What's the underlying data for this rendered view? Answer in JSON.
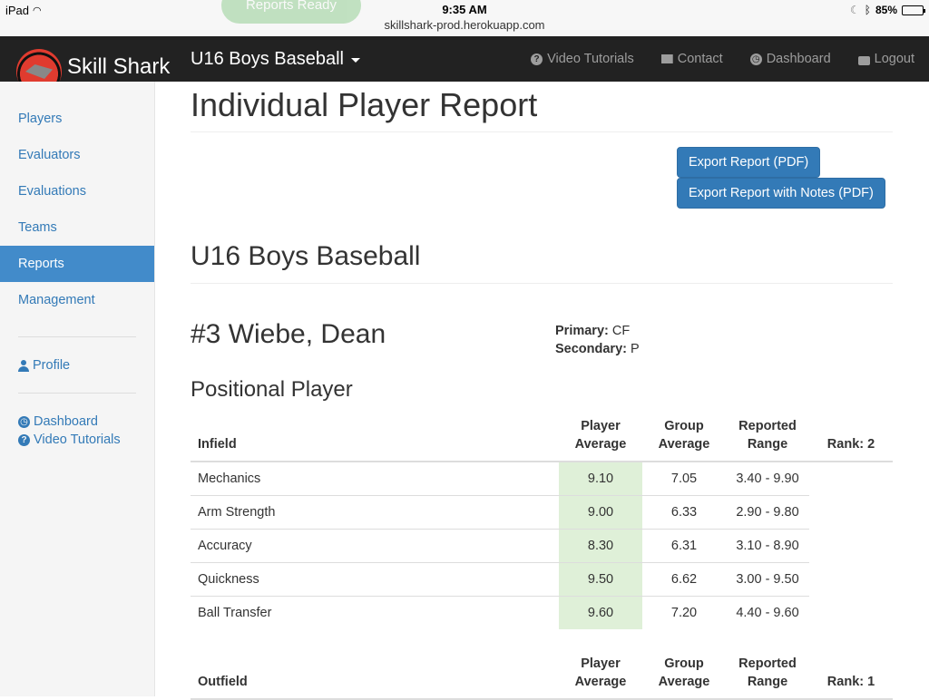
{
  "ios_bar": {
    "device": "iPad",
    "time": "9:35 AM",
    "url": "skillshark-prod.herokuapp.com",
    "battery": "85%",
    "battery_level": 0.85,
    "ghost_pill": "Reports Ready"
  },
  "navbar": {
    "brand": "Skill Shark",
    "team": "U16 Boys Baseball",
    "links": [
      {
        "label": "Video Tutorials",
        "icon": "question-circle-icon"
      },
      {
        "label": "Contact",
        "icon": "envelope-icon"
      },
      {
        "label": "Dashboard",
        "icon": "dashboard-icon"
      },
      {
        "label": "Logout",
        "icon": "lock-icon"
      }
    ]
  },
  "sidebar": {
    "items": [
      {
        "label": "Players"
      },
      {
        "label": "Evaluators"
      },
      {
        "label": "Evaluations"
      },
      {
        "label": "Teams"
      },
      {
        "label": "Reports",
        "active": true
      },
      {
        "label": "Management"
      }
    ],
    "profile": "Profile",
    "dashboard": "Dashboard",
    "video_tutorials": "Video Tutorials"
  },
  "main": {
    "title": "Individual Player Report",
    "export_pdf": "Export Report (PDF)",
    "export_notes_pdf": "Export Report with Notes (PDF)",
    "team_title": "U16 Boys Baseball",
    "player_name": "#3 Wiebe, Dean",
    "primary_label": "Primary:",
    "primary_value": "CF",
    "secondary_label": "Secondary:",
    "secondary_value": "P",
    "section": "Positional Player",
    "col_player_1": "Player",
    "col_player_2": "Average",
    "col_group_1": "Group",
    "col_group_2": "Average",
    "col_range_1": "Reported",
    "col_range_2": "Range",
    "infield": {
      "label": "Infield",
      "rank": "Rank: 2",
      "rows": [
        {
          "name": "Mechanics",
          "player": "9.10",
          "group": "7.05",
          "range": "3.40 - 9.90"
        },
        {
          "name": "Arm Strength",
          "player": "9.00",
          "group": "6.33",
          "range": "2.90 - 9.80"
        },
        {
          "name": "Accuracy",
          "player": "8.30",
          "group": "6.31",
          "range": "3.10 - 8.90"
        },
        {
          "name": "Quickness",
          "player": "9.50",
          "group": "6.62",
          "range": "3.00 - 9.50"
        },
        {
          "name": "Ball Transfer",
          "player": "9.60",
          "group": "7.20",
          "range": "4.40 - 9.60"
        }
      ]
    },
    "outfield": {
      "label": "Outfield",
      "rank": "Rank: 1"
    }
  },
  "colors": {
    "navbar": "#222222",
    "accent": "#337ab7",
    "active_sidebar": "#428bca",
    "highlight": "#dff0d8"
  }
}
